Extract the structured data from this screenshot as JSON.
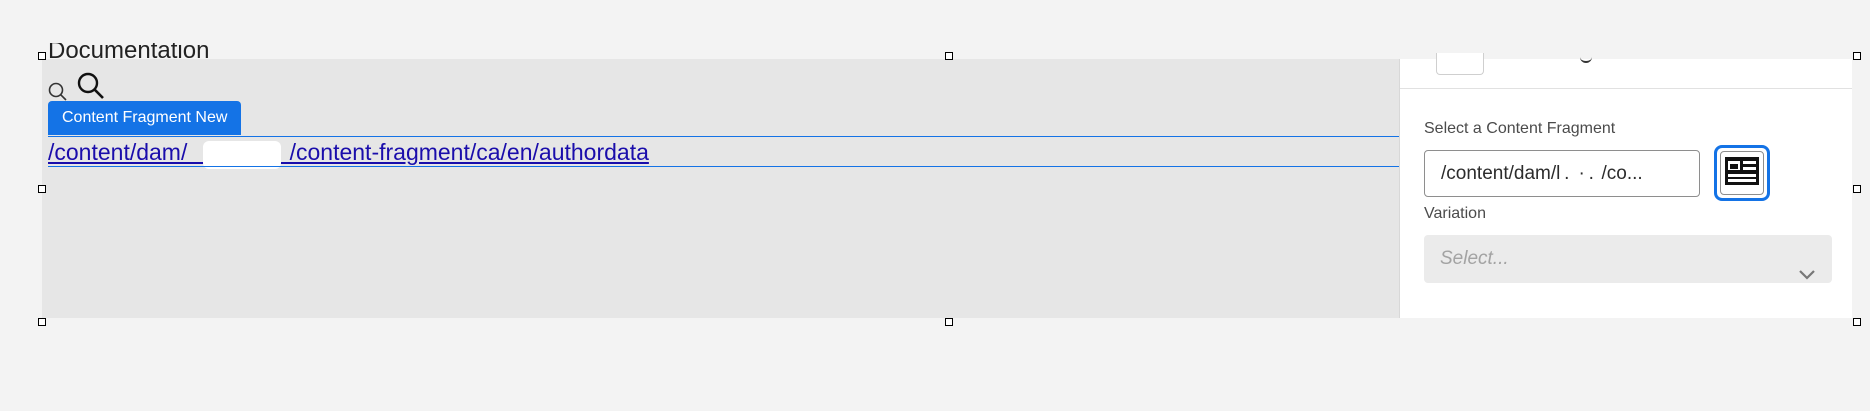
{
  "canvas": {
    "doc_title": "Documentation",
    "content_fragment_chip": "Content Fragment New",
    "fragment_link": "/content/dam/                /content-fragment/ca/en/authordata"
  },
  "panel": {
    "header_tab": "",
    "fragment_label": "Select a Content Fragment",
    "fragment_value": "/content/dam/l .  · .  /co...",
    "variation_label": "Variation",
    "variation_placeholder": "Select..."
  },
  "icons": [
    "search-icon",
    "search-icon",
    "card-picker-icon",
    "chevron-down-icon"
  ],
  "colors": {
    "accent": "#1473e6",
    "link": "#1a0dab",
    "canvas": "#e6e6e6",
    "page": "#f3f3f3"
  }
}
